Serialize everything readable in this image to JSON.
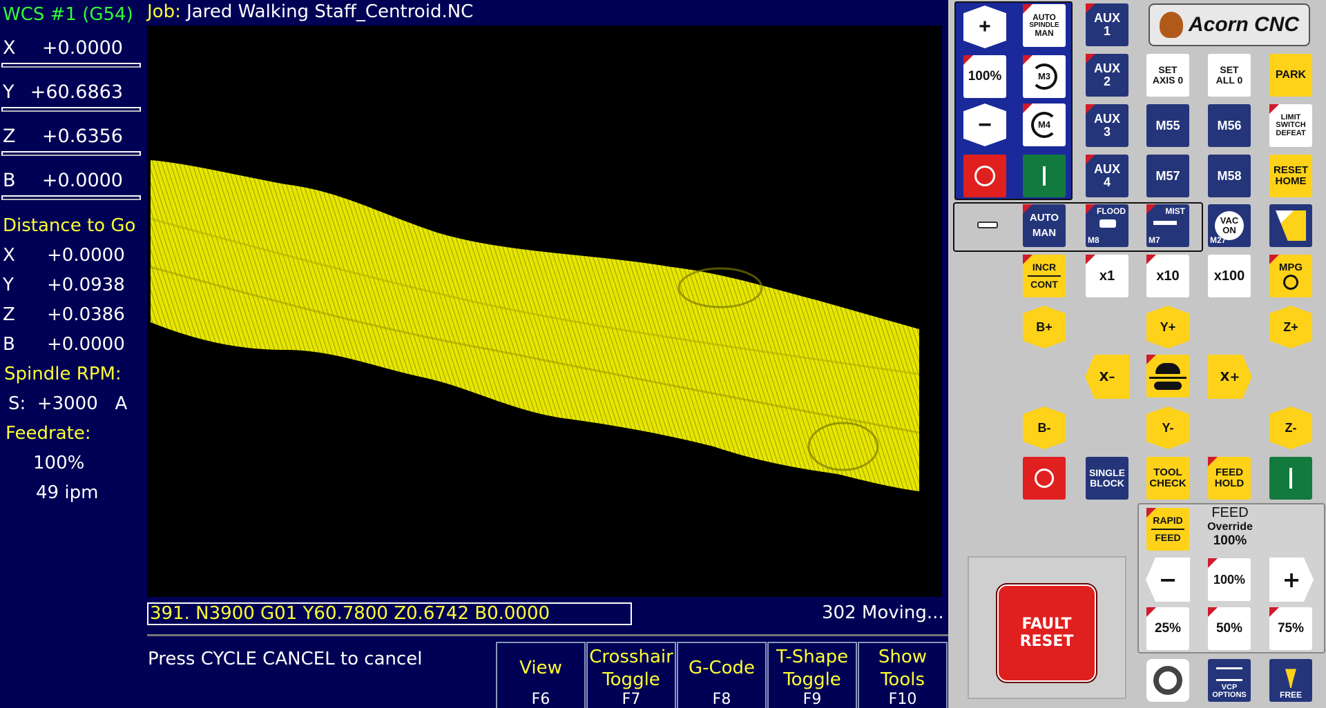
{
  "dro": {
    "wcs": "WCS #1 (G54)",
    "axes": [
      {
        "axis": "X",
        "value": "+0.0000"
      },
      {
        "axis": "Y",
        "value": "+60.6863"
      },
      {
        "axis": "Z",
        "value": "+0.6356"
      },
      {
        "axis": "B",
        "value": "+0.0000"
      }
    ],
    "dtg_label": "Distance to Go",
    "dtg": [
      {
        "axis": "X",
        "value": "+0.0000"
      },
      {
        "axis": "Y",
        "value": "+0.0938"
      },
      {
        "axis": "Z",
        "value": "+0.0386"
      },
      {
        "axis": "B",
        "value": "+0.0000"
      }
    ],
    "spindle_label": "Spindle RPM:",
    "spindle_value": "S:  +3000   A",
    "feedrate_label": "Feedrate:",
    "feed_pct": "100%",
    "feed_ipm": "49 ipm"
  },
  "job": {
    "label": "Job:",
    "name": "Jared Walking Staff_Centroid.NC"
  },
  "gcode_line": "391. N3900 G01 Y60.7800 Z0.6742 B0.0000",
  "status": "302 Moving...",
  "prompt": "Press CYCLE CANCEL to cancel",
  "fkeys": [
    {
      "label1": "View",
      "label2": "",
      "key": "F6"
    },
    {
      "label1": "Crosshair",
      "label2": "Toggle",
      "key": "F7"
    },
    {
      "label1": "G-Code",
      "label2": "",
      "key": "F8"
    },
    {
      "label1": "T-Shape",
      "label2": "Toggle",
      "key": "F9"
    },
    {
      "label1": "Show",
      "label2": "Tools",
      "key": "F10"
    }
  ],
  "panel": {
    "logo": "Acorn CNC",
    "spindle": {
      "plus": "+",
      "pct": "100%",
      "minus": "−",
      "auto": "AUTO",
      "spindle": "SPINDLE",
      "man": "MAN",
      "m3": "M3",
      "m4": "M4"
    },
    "aux": [
      "AUX\n1",
      "AUX\n2",
      "AUX\n3",
      "AUX\n4"
    ],
    "set_axis": "SET\nAXIS 0",
    "set_all": "SET\nALL 0",
    "park": "PARK",
    "m55": "M55",
    "m56": "M56",
    "m57": "M57",
    "m58": "M58",
    "limit": "LIMIT\nSWITCH\nDEFEAT",
    "reset_home": "RESET\nHOME",
    "coolant_auto": "AUTO",
    "coolant_man": "MAN",
    "flood": "FLOOD",
    "m8": "M8",
    "mist": "MIST",
    "m7": "M7",
    "vac": "VAC\nON",
    "m27": "M27",
    "incr": "INCR",
    "cont": "CONT",
    "x1": "x1",
    "x10": "x10",
    "x100": "x100",
    "mpg": "MPG",
    "jog": {
      "bplus": "B+",
      "yplus": "Y+",
      "zplus": "Z+",
      "xminus": "X–",
      "xplus": "X+",
      "bminus": "B-",
      "yminus": "Y-",
      "zminus": "Z-"
    },
    "single_block": "SINGLE\nBLOCK",
    "tool_check": "TOOL\nCHECK",
    "feed_hold": "FEED\nHOLD",
    "rapid": "RAPID",
    "feed": "FEED",
    "feed_title": "FEED",
    "override": "Override",
    "override_pct": "100%",
    "fo_minus": "−",
    "fo_100": "100%",
    "fo_plus": "+",
    "fo_25": "25%",
    "fo_50": "50%",
    "fo_75": "75%",
    "fault_reset": "FAULT\nRESET",
    "vcp_options": "VCP\nOPTIONS",
    "free": "FREE"
  }
}
